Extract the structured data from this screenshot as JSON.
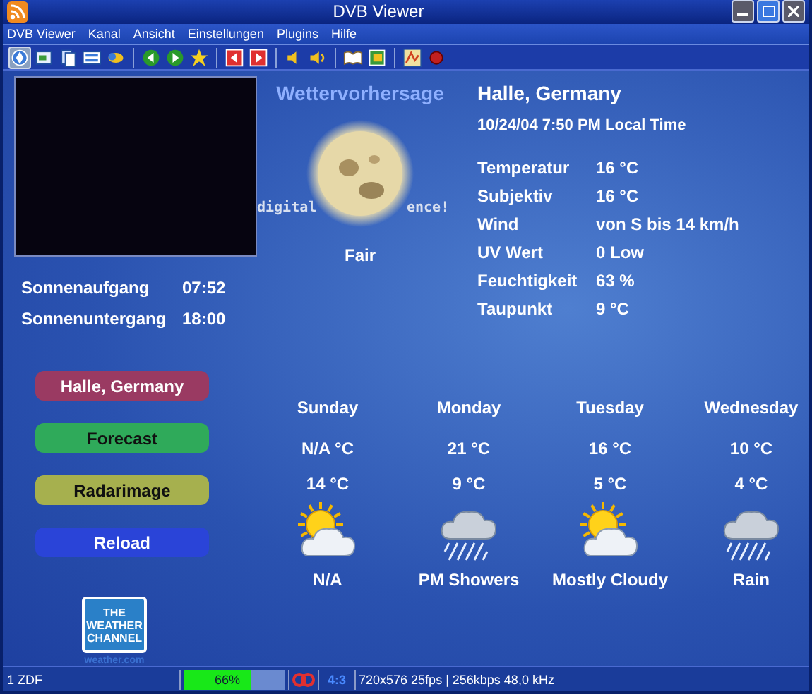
{
  "window": {
    "title": "DVB Viewer"
  },
  "menu": [
    "DVB Viewer",
    "Kanal",
    "Ansicht",
    "Einstellungen",
    "Plugins",
    "Hilfe"
  ],
  "toolbar": [
    {
      "pressed": true
    },
    {
      "pressed": false
    },
    {
      "pressed": false
    },
    {
      "pressed": false
    },
    {
      "pressed": false
    },
    {
      "pressed": false
    },
    {
      "pressed": false
    },
    {
      "pressed": false
    },
    {
      "pressed": false
    },
    {
      "pressed": false
    },
    {
      "pressed": false
    },
    {
      "pressed": false
    },
    {
      "pressed": false
    },
    {
      "pressed": false
    },
    {
      "pressed": false
    },
    {
      "pressed": false
    }
  ],
  "sun": [
    {
      "label": "Sonnenaufgang",
      "value": "07:52"
    },
    {
      "label": "Sonnenuntergang",
      "value": "18:00"
    }
  ],
  "buttons": [
    {
      "label": "Halle, Germany",
      "color": "#9a3a62"
    },
    {
      "label": "Forecast",
      "color": "#2faa5a"
    },
    {
      "label": "Radarimage",
      "color": "#a6b04e"
    },
    {
      "label": "Reload",
      "color": "#2a44d8"
    }
  ],
  "logo": {
    "lines": [
      "THE",
      "WEATHER",
      "CHANNEL"
    ],
    "caption": "weather.com"
  },
  "heading": "Wettervorhersage",
  "watermark": [
    "digital",
    "ence!"
  ],
  "current": {
    "condition": "Fair",
    "location": "Halle, Germany",
    "time": "10/24/04 7:50 PM Local Time"
  },
  "details": [
    {
      "label": "Temperatur",
      "value": "16 °C"
    },
    {
      "label": "Subjektiv",
      "value": "16 °C"
    },
    {
      "label": "Wind",
      "value": "von S bis 14 km/h"
    },
    {
      "label": "UV Wert",
      "value": "0 Low"
    },
    {
      "label": "Feuchtigkeit",
      "value": "63 %"
    },
    {
      "label": "Taupunkt",
      "value": "9 °C"
    }
  ],
  "forecast": [
    {
      "day": "Sunday",
      "high": "N/A °C",
      "low": "14 °C",
      "kind": "sun-cloud",
      "text": "N/A"
    },
    {
      "day": "Monday",
      "high": "21 °C",
      "low": "9 °C",
      "kind": "rain",
      "text": "PM Showers"
    },
    {
      "day": "Tuesday",
      "high": "16 °C",
      "low": "5 °C",
      "kind": "sun-cloud",
      "text": "Mostly Cloudy"
    },
    {
      "day": "Wednesday",
      "high": "10 °C",
      "low": "4 °C",
      "kind": "rain",
      "text": "Rain"
    }
  ],
  "status_bar": {
    "channel": "1 ZDF",
    "signal": {
      "level": 0.66,
      "reading": "66%"
    },
    "aspect": "4:3",
    "info": "720x576 25fps | 256kbps 48,0 kHz"
  }
}
